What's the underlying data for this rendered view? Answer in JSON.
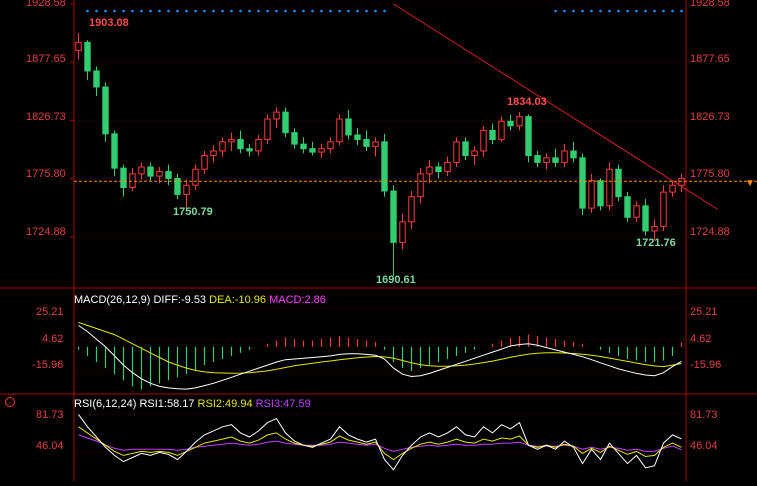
{
  "colors": {
    "background": "#000000",
    "grid": "#8b0000",
    "up": "#ff3b3b",
    "down": "#32cd70",
    "trendline": "#d62020",
    "price_label": "#e04040",
    "high_label": "#ff4d4d",
    "low_label": "#7fd7a0",
    "diff": "#ffffff",
    "dea": "#e6e600",
    "macd": "#ff40ff",
    "rsi1": "#ffffff",
    "rsi2": "#e6e600",
    "rsi3": "#c040ff",
    "signal_dots": "#1e90ff",
    "current_price_line": "#ff8c00"
  },
  "price_panel": {
    "y_ticks": [
      "1928.58",
      "1877.65",
      "1826.73",
      "1775.80",
      "1724.88"
    ],
    "annotations": {
      "high": "1903.08",
      "low_a": "1750.79",
      "low_b": "1690.61",
      "peak": "1834.03",
      "low_c": "1721.76"
    }
  },
  "macd_panel": {
    "label": "MACD(26,12,9)",
    "diff_label": "DIFF:-9.53",
    "dea_label": "DEA:-10.96",
    "macd_label": "MACD:2.86",
    "y_ticks": [
      "25.21",
      "4.62",
      "-15.96"
    ]
  },
  "rsi_panel": {
    "label": "RSI(6,12,24)",
    "rsi1_label": "RSI1:58.17",
    "rsi2_label": "RSI2:49.94",
    "rsi3_label": "RSI3:47.59",
    "y_ticks": [
      "81.73",
      "46.04"
    ]
  },
  "chart_data": [
    {
      "type": "candlestick",
      "title": "",
      "ylim": [
        1690.61,
        1928.58
      ],
      "yticks": [
        1928.58,
        1877.65,
        1826.73,
        1775.8,
        1724.88
      ],
      "grid": true,
      "ohlc": [
        [
          1888,
          1903.08,
          1880,
          1895
        ],
        [
          1895,
          1897,
          1862,
          1870
        ],
        [
          1870,
          1874,
          1848,
          1856
        ],
        [
          1856,
          1860,
          1808,
          1815
        ],
        [
          1815,
          1818,
          1778,
          1785
        ],
        [
          1785,
          1788,
          1760,
          1768
        ],
        [
          1768,
          1785,
          1765,
          1780
        ],
        [
          1780,
          1790,
          1775,
          1786
        ],
        [
          1786,
          1790,
          1774,
          1778
        ],
        [
          1778,
          1786,
          1772,
          1782
        ],
        [
          1782,
          1788,
          1770,
          1776
        ],
        [
          1776,
          1780,
          1758,
          1762
        ],
        [
          1762,
          1775,
          1750.79,
          1770
        ],
        [
          1770,
          1788,
          1766,
          1784
        ],
        [
          1784,
          1800,
          1780,
          1796
        ],
        [
          1796,
          1805,
          1790,
          1800
        ],
        [
          1800,
          1812,
          1795,
          1808
        ],
        [
          1808,
          1816,
          1800,
          1810
        ],
        [
          1810,
          1818,
          1798,
          1802
        ],
        [
          1802,
          1806,
          1795,
          1800
        ],
        [
          1800,
          1814,
          1796,
          1810
        ],
        [
          1810,
          1832,
          1806,
          1828
        ],
        [
          1828,
          1838,
          1820,
          1834
        ],
        [
          1834,
          1838,
          1812,
          1816
        ],
        [
          1816,
          1820,
          1802,
          1806
        ],
        [
          1806,
          1812,
          1798,
          1802
        ],
        [
          1802,
          1808,
          1796,
          1799
        ],
        [
          1799,
          1806,
          1794,
          1802
        ],
        [
          1802,
          1812,
          1798,
          1808
        ],
        [
          1808,
          1832,
          1805,
          1828
        ],
        [
          1828,
          1836,
          1810,
          1814
        ],
        [
          1814,
          1820,
          1805,
          1810
        ],
        [
          1810,
          1818,
          1800,
          1804
        ],
        [
          1804,
          1812,
          1795,
          1808
        ],
        [
          1808,
          1815,
          1760,
          1765
        ],
        [
          1765,
          1770,
          1690.61,
          1720
        ],
        [
          1720,
          1745,
          1714,
          1738
        ],
        [
          1738,
          1765,
          1732,
          1760
        ],
        [
          1760,
          1785,
          1754,
          1780
        ],
        [
          1780,
          1792,
          1772,
          1786
        ],
        [
          1786,
          1790,
          1776,
          1782
        ],
        [
          1782,
          1795,
          1778,
          1790
        ],
        [
          1790,
          1812,
          1786,
          1808
        ],
        [
          1808,
          1812,
          1792,
          1796
        ],
        [
          1796,
          1804,
          1788,
          1800
        ],
        [
          1800,
          1822,
          1795,
          1818
        ],
        [
          1818,
          1824,
          1806,
          1810
        ],
        [
          1810,
          1830,
          1808,
          1826
        ],
        [
          1826,
          1832,
          1818,
          1822
        ],
        [
          1822,
          1834.03,
          1818,
          1830
        ],
        [
          1830,
          1832,
          1790,
          1796
        ],
        [
          1796,
          1800,
          1786,
          1790
        ],
        [
          1790,
          1798,
          1784,
          1794
        ],
        [
          1794,
          1802,
          1786,
          1790
        ],
        [
          1790,
          1806,
          1786,
          1800
        ],
        [
          1800,
          1808,
          1790,
          1794
        ],
        [
          1794,
          1798,
          1744,
          1750
        ],
        [
          1750,
          1780,
          1746,
          1774
        ],
        [
          1774,
          1776,
          1748,
          1752
        ],
        [
          1752,
          1790,
          1748,
          1784
        ],
        [
          1784,
          1788,
          1756,
          1760
        ],
        [
          1760,
          1764,
          1738,
          1742
        ],
        [
          1742,
          1756,
          1738,
          1752
        ],
        [
          1752,
          1758,
          1726,
          1730
        ],
        [
          1730,
          1740,
          1721.76,
          1734
        ],
        [
          1734,
          1770,
          1730,
          1764
        ],
        [
          1764,
          1774,
          1760,
          1770
        ],
        [
          1770,
          1780,
          1764,
          1776
        ]
      ],
      "current_price": 1773.5,
      "trendline": {
        "from": [
          35,
          1928.58
        ],
        "to": [
          71,
          1749
        ]
      }
    },
    {
      "type": "bar",
      "title": "MACD(26,12,9)",
      "ylim": [
        -31,
        36
      ],
      "yticks": [
        25.21,
        4.62,
        -15.96
      ],
      "macd_hist": [
        -2,
        -6,
        -10,
        -14,
        -18,
        -22,
        -26,
        -28,
        -26,
        -24,
        -22,
        -20,
        -18,
        -16,
        -12,
        -10,
        -8,
        -6,
        -4,
        -2,
        0,
        2,
        4,
        6,
        5,
        4,
        4,
        5,
        6,
        7,
        6,
        5,
        4,
        3,
        -2,
        -10,
        -14,
        -16,
        -14,
        -12,
        -10,
        -8,
        -6,
        -4,
        -2,
        0,
        2,
        4,
        6,
        7,
        8,
        7,
        6,
        5,
        4,
        3,
        2,
        0,
        -2,
        -4,
        -6,
        -8,
        -9,
        -10,
        -10,
        -9,
        -6,
        2.86
      ],
      "diff": [
        14,
        10,
        5,
        0,
        -6,
        -12,
        -17,
        -21,
        -24,
        -26,
        -27,
        -27.5,
        -27.8,
        -27,
        -25.5,
        -24,
        -22,
        -20,
        -18,
        -16,
        -14,
        -12,
        -10,
        -8.5,
        -8,
        -7.5,
        -7,
        -6.5,
        -6,
        -5,
        -4.5,
        -4.5,
        -5,
        -5.5,
        -8,
        -14,
        -18,
        -19.5,
        -19,
        -17.5,
        -15.5,
        -13.5,
        -11.5,
        -9.5,
        -7.5,
        -5.5,
        -3.5,
        -1.5,
        0.5,
        1.5,
        2,
        1,
        -0.5,
        -2,
        -3.5,
        -5,
        -6.5,
        -8.5,
        -10.5,
        -12.5,
        -14.5,
        -16,
        -17.5,
        -18.5,
        -19,
        -17,
        -13,
        -9.53
      ],
      "dea": [
        16,
        14,
        12,
        10,
        8,
        5,
        2,
        -1,
        -4,
        -7,
        -10,
        -12,
        -14,
        -15.5,
        -16.5,
        -17,
        -17.2,
        -17.4,
        -17.3,
        -17,
        -16.5,
        -15.8,
        -14.8,
        -13.6,
        -12.5,
        -11.6,
        -10.8,
        -10,
        -9.3,
        -8.5,
        -7.8,
        -7.2,
        -6.7,
        -6.4,
        -6.6,
        -7.5,
        -9,
        -10.5,
        -11.8,
        -12.5,
        -12.8,
        -12.8,
        -12.5,
        -12,
        -11.3,
        -10.4,
        -9.4,
        -8.2,
        -6.9,
        -5.8,
        -4.8,
        -4.2,
        -3.9,
        -3.9,
        -4.1,
        -4.4,
        -4.9,
        -5.6,
        -6.4,
        -7.4,
        -8.5,
        -9.6,
        -10.7,
        -11.7,
        -12.6,
        -13,
        -12,
        -10.96
      ]
    },
    {
      "type": "line",
      "title": "RSI(6,12,24)",
      "ylim": [
        20,
        100
      ],
      "yticks": [
        81.73,
        46.04
      ],
      "rsi1": [
        82,
        70,
        60,
        50,
        42,
        36,
        40,
        44,
        42,
        45,
        43,
        38,
        46,
        55,
        62,
        66,
        70,
        72,
        64,
        60,
        66,
        74,
        78,
        64,
        56,
        52,
        50,
        54,
        58,
        70,
        62,
        58,
        55,
        58,
        38,
        28,
        42,
        52,
        60,
        64,
        60,
        64,
        70,
        62,
        60,
        70,
        64,
        72,
        68,
        74,
        52,
        48,
        52,
        48,
        56,
        50,
        34,
        48,
        38,
        54,
        44,
        34,
        42,
        30,
        32,
        54,
        62,
        58.17
      ],
      "rsi2": [
        70,
        64,
        58,
        52,
        46,
        42,
        44,
        46,
        45,
        46,
        45,
        42,
        46,
        50,
        54,
        56,
        58,
        60,
        56,
        54,
        57,
        62,
        64,
        58,
        54,
        52,
        51,
        53,
        55,
        61,
        57,
        55,
        53,
        55,
        44,
        38,
        44,
        49,
        53,
        55,
        53,
        55,
        58,
        55,
        54,
        58,
        56,
        59,
        58,
        61,
        52,
        50,
        52,
        50,
        53,
        51,
        44,
        49,
        45,
        51,
        47,
        43,
        46,
        41,
        42,
        50,
        54,
        49.94
      ],
      "rsi3": [
        62,
        59,
        56,
        52,
        49,
        47,
        48,
        48,
        48,
        48,
        48,
        47,
        48,
        50,
        51,
        52,
        53,
        54,
        53,
        52,
        53,
        55,
        56,
        54,
        53,
        52,
        52,
        52,
        53,
        55,
        54,
        53,
        52,
        53,
        49,
        46,
        48,
        50,
        51,
        52,
        51,
        52,
        53,
        52,
        52,
        53,
        53,
        54,
        54,
        55,
        52,
        51,
        51,
        51,
        52,
        51,
        48,
        50,
        48,
        50,
        49,
        47,
        48,
        46,
        46,
        49,
        51,
        47.59
      ]
    }
  ]
}
